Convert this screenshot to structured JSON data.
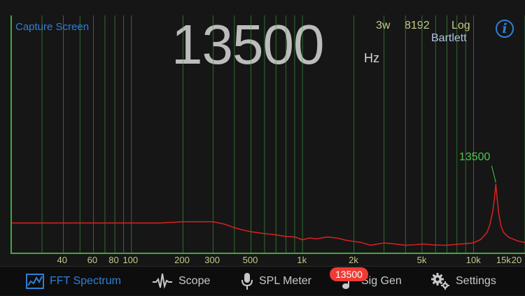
{
  "header": {
    "capture_label": "Capture Screen",
    "frequency_value": "13500",
    "frequency_unit": "Hz",
    "average_mode": "3w",
    "fft_size": "8192",
    "scale": "Log",
    "window": "Bartlett",
    "info_glyph": "i"
  },
  "chart_data": {
    "type": "line",
    "x_scale": "log",
    "xlim": [
      20,
      20000
    ],
    "ylim": [
      0,
      100
    ],
    "grid": true,
    "tick_labels": [
      "40",
      "60",
      "80",
      "100",
      "200",
      "300",
      "500",
      "1k",
      "2k",
      "5k",
      "10k",
      "15k",
      "20"
    ],
    "tick_values": [
      40,
      60,
      80,
      100,
      200,
      300,
      500,
      1000,
      2000,
      5000,
      10000,
      15000,
      20000
    ],
    "grid_values": [
      30,
      40,
      50,
      60,
      70,
      80,
      90,
      100,
      200,
      300,
      400,
      500,
      600,
      700,
      800,
      900,
      1000,
      2000,
      3000,
      4000,
      5000,
      6000,
      7000,
      8000,
      9000,
      10000,
      20000
    ],
    "peak": {
      "label": "13500",
      "x": 13500,
      "y": 29
    },
    "series": [
      {
        "color": "#e02020",
        "x": [
          20,
          30,
          40,
          60,
          80,
          100,
          150,
          200,
          250,
          300,
          350,
          400,
          450,
          500,
          600,
          700,
          800,
          900,
          1000,
          1100,
          1200,
          1400,
          1600,
          1800,
          2000,
          2200,
          2500,
          3000,
          3500,
          4000,
          4500,
          5000,
          6000,
          7000,
          8000,
          9000,
          10000,
          11000,
          12000,
          12500,
          13000,
          13300,
          13500,
          13700,
          14000,
          14500,
          15000,
          16000,
          18000,
          20000
        ],
        "y": [
          12.5,
          12.5,
          12.5,
          12.5,
          12.5,
          12.5,
          12.5,
          13,
          13,
          13,
          12,
          10.5,
          9.5,
          8.8,
          8,
          7.5,
          6.8,
          6.6,
          5.4,
          6.2,
          5.8,
          6.6,
          6.1,
          5.2,
          4.7,
          4.3,
          3.1,
          4.1,
          3.6,
          3.1,
          3.3,
          3.6,
          3.2,
          3.1,
          3.5,
          3.8,
          4.1,
          5.5,
          8.5,
          12,
          18,
          24,
          29,
          24,
          17,
          11,
          8.5,
          6.5,
          5,
          4.2
        ]
      }
    ]
  },
  "tabs": [
    {
      "label": "FFT Spectrum",
      "icon": "fft-spectrum-icon",
      "active": true
    },
    {
      "label": "Scope",
      "icon": "scope-wave-icon",
      "active": false
    },
    {
      "label": "SPL Meter",
      "icon": "microphone-icon",
      "active": false
    },
    {
      "label": "Sig Gen",
      "icon": "music-note-icon",
      "active": false,
      "badge": "13500"
    },
    {
      "label": "Settings",
      "icon": "gears-icon",
      "active": false
    }
  ],
  "colors": {
    "accent": "#2f7fd6",
    "grid": "#3fa83f",
    "trace": "#e02020",
    "tick_text": "#c7c98a",
    "badge": "#ee3b34"
  }
}
